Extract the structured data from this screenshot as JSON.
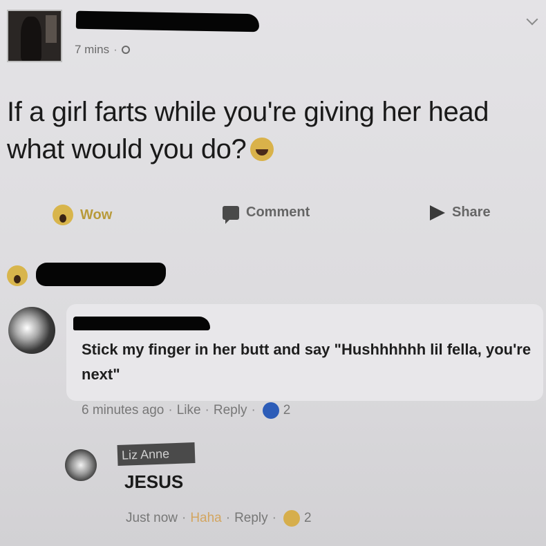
{
  "post": {
    "time": "7 mins",
    "separator": "·",
    "text": "If a girl farts while you're giving her head what would you do?"
  },
  "actions": {
    "wow_label": "Wow",
    "comment_label": "Comment",
    "share_label": "Share"
  },
  "comment": {
    "text": "Stick my finger in her butt and say \"Hushhhhhh lil fella, you're next\"",
    "time": "6 minutes ago",
    "like_label": "Like",
    "reply_label": "Reply",
    "reaction_count": "2"
  },
  "reply": {
    "author": "Liz Anne",
    "text": "JESUS",
    "time": "Just now",
    "haha_label": "Haha",
    "reply_label": "Reply",
    "reaction_count": "2"
  },
  "colors": {
    "wow": "#d8b54c",
    "like": "#2d5db8",
    "haha": "#d3a560"
  },
  "icons": [
    "globe-icon",
    "chevron-down-icon",
    "wow-icon",
    "comment-icon",
    "share-icon",
    "laughing-emoji-icon",
    "like-icon",
    "haha-icon"
  ]
}
